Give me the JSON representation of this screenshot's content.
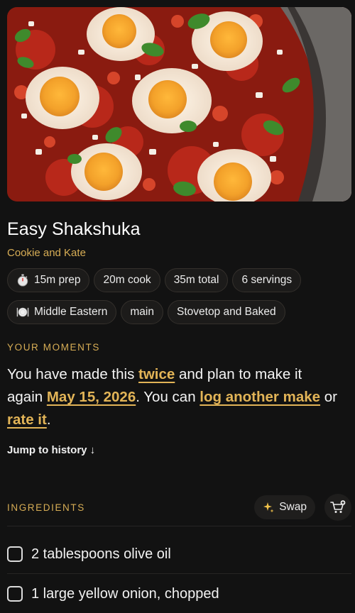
{
  "recipe": {
    "title": "Easy Shakshuka",
    "source": "Cookie and Kate",
    "hero_image": "shakshuka-photo"
  },
  "times": [
    {
      "icon": "stopwatch-icon",
      "label": "15m prep"
    },
    {
      "icon": null,
      "label": "20m cook"
    },
    {
      "icon": null,
      "label": "35m total"
    },
    {
      "icon": null,
      "label": "6 servings"
    }
  ],
  "tags": [
    {
      "icon": "plate-cutlery-icon",
      "label": "Middle Eastern"
    },
    {
      "icon": null,
      "label": "main"
    },
    {
      "icon": null,
      "label": "Stovetop and Baked"
    }
  ],
  "moments": {
    "label": "YOUR MOMENTS",
    "text_1": "You have made this ",
    "made_count": "twice",
    "text_2": " and plan to make it again ",
    "plan_date": "May 15, 2026",
    "text_3": ". You can ",
    "log_link": "log another make",
    "text_4": " or ",
    "rate_link": "rate it",
    "text_5": ".",
    "jump_label": "Jump to history ↓"
  },
  "ingredients": {
    "label": "INGREDIENTS",
    "swap_label": "Swap",
    "items": [
      "2 tablespoons olive oil",
      "1 large yellow onion, chopped"
    ]
  },
  "colors": {
    "accent": "#d7ad55",
    "link": "#e2b457",
    "background": "#121212"
  }
}
